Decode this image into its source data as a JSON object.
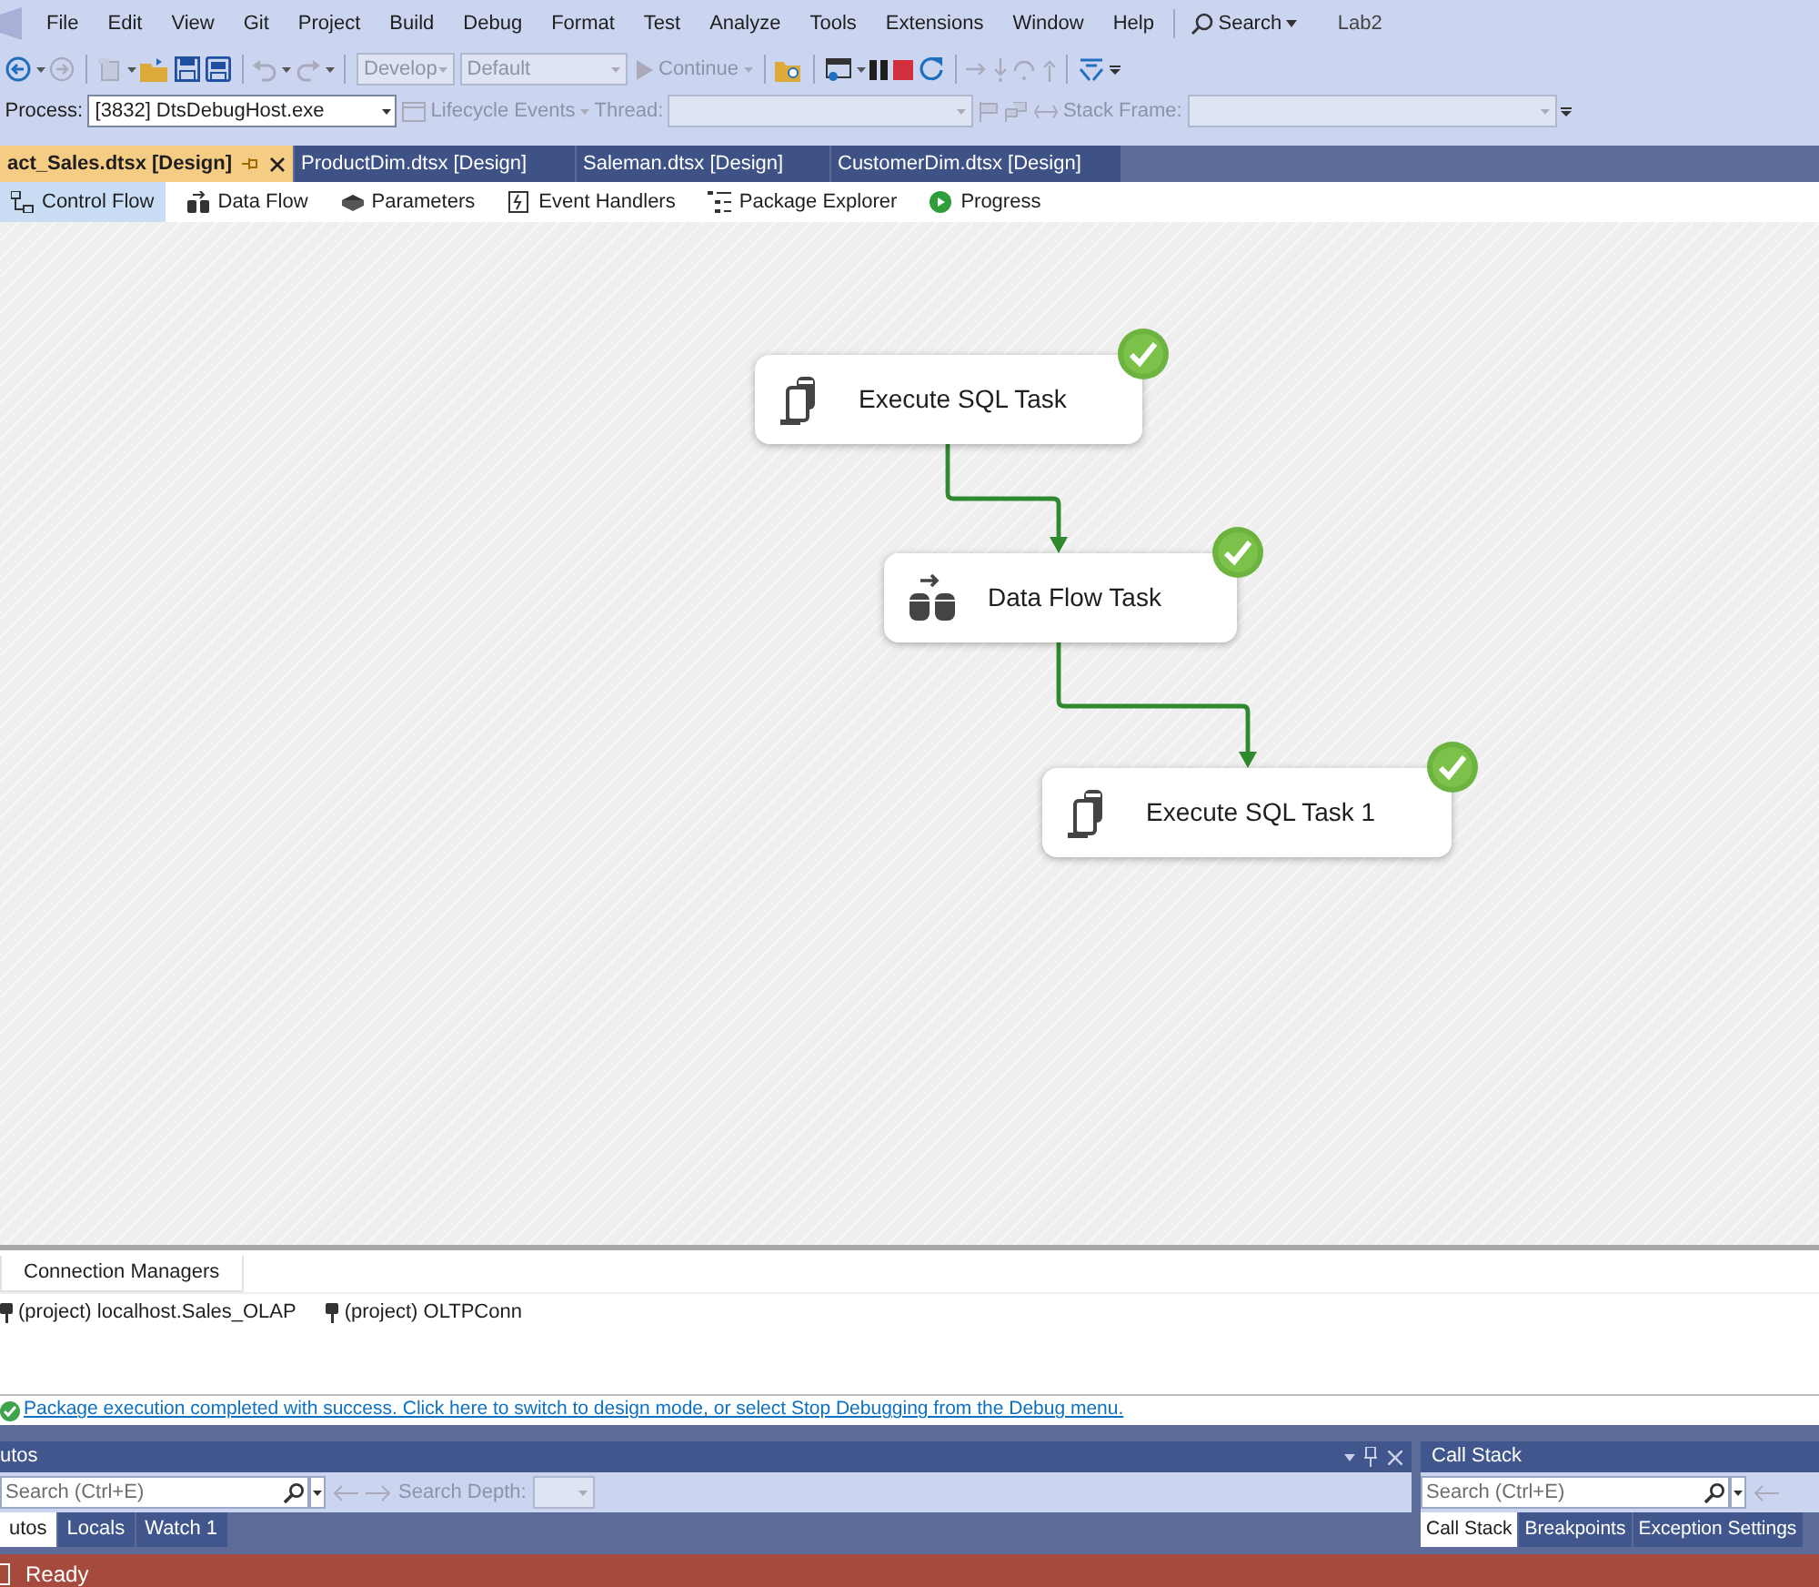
{
  "menu": {
    "items": [
      "File",
      "Edit",
      "View",
      "Git",
      "Project",
      "Build",
      "Debug",
      "Format",
      "Test",
      "Analyze",
      "Tools",
      "Extensions",
      "Window",
      "Help"
    ],
    "search": "Search",
    "solution": "Lab2"
  },
  "toolbar": {
    "configuration": "Develop",
    "platform": "Default",
    "continue": "Continue"
  },
  "debug_location": {
    "process_label": "Process:",
    "process": "[3832] DtsDebugHost.exe",
    "lifecycle": "Lifecycle Events",
    "thread_label": "Thread:",
    "stack_frame_label": "Stack Frame:"
  },
  "document_tabs": [
    {
      "label": "act_Sales.dtsx [Design]",
      "selected": true
    },
    {
      "label": "ProductDim.dtsx [Design]",
      "selected": false
    },
    {
      "label": "Saleman.dtsx [Design]",
      "selected": false
    },
    {
      "label": "CustomerDim.dtsx [Design]",
      "selected": false
    }
  ],
  "designer_tabs": [
    {
      "label": "Control Flow",
      "kind": "control-flow",
      "selected": true
    },
    {
      "label": "Data Flow",
      "kind": "data-flow",
      "selected": false
    },
    {
      "label": "Parameters",
      "kind": "parameters",
      "selected": false
    },
    {
      "label": "Event Handlers",
      "kind": "event-handlers",
      "selected": false
    },
    {
      "label": "Package Explorer",
      "kind": "package-explorer",
      "selected": false
    },
    {
      "label": "Progress",
      "kind": "progress",
      "selected": false
    }
  ],
  "nodes": [
    {
      "label": "Execute SQL Task",
      "kind": "sql",
      "succeeded": true
    },
    {
      "label": "Data Flow Task",
      "kind": "dataflow",
      "succeeded": true
    },
    {
      "label": "Execute SQL Task 1",
      "kind": "sql",
      "succeeded": true
    }
  ],
  "connection_managers": {
    "tab": "Connection Managers",
    "items": [
      "(project) localhost.Sales_OLAP",
      "(project) OLTPConn"
    ]
  },
  "info_bar": "Package execution completed with success. Click here to switch to design mode, or select Stop Debugging from the Debug menu.",
  "autos_panel": {
    "title": "utos",
    "search_placeholder": "Search (Ctrl+E)",
    "search_depth_label": "Search Depth:",
    "tabs": [
      {
        "label": "utos",
        "selected": true
      },
      {
        "label": "Locals",
        "selected": false
      },
      {
        "label": "Watch 1",
        "selected": false
      }
    ]
  },
  "call_stack_panel": {
    "title": "Call Stack",
    "search_placeholder": "Search (Ctrl+E)",
    "tabs": [
      {
        "label": "Call Stack",
        "selected": true
      },
      {
        "label": "Breakpoints",
        "selected": false
      },
      {
        "label": "Exception Settings",
        "selected": false
      }
    ]
  },
  "status_bar": "Ready"
}
